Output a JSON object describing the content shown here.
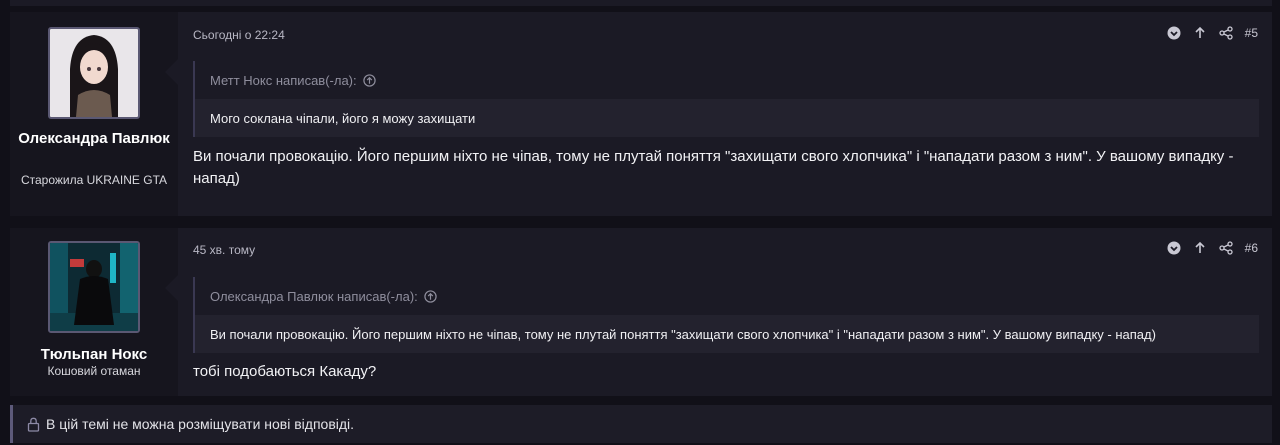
{
  "posts": [
    {
      "user": {
        "name": "Олександра Павлюк",
        "title": "Старожила UKRAINE GTA"
      },
      "time": "Сьогодні о 22:24",
      "number": "#5",
      "quote": {
        "author": "Метт Нокс написав(-ла):",
        "text": "Мого соклана чіпали, його я можу захищати"
      },
      "message": "Ви почали провокацію. Його першим ніхто не чіпав, тому не плутай поняття \"захищати свого хлопчика\" і \"нападати разом з ним\". У вашому випадку - напад)"
    },
    {
      "user": {
        "name": "Тюльпан Нокс",
        "title": "Кошовий отаман"
      },
      "time": "45 хв. тому",
      "number": "#6",
      "quote": {
        "author": "Олександра Павлюк написав(-ла):",
        "text": "Ви почали провокацію. Його першим ніхто не чіпав, тому не плутай поняття \"захищати свого хлопчика\" і \"нападати разом з ним\". У вашому випадку - напад)"
      },
      "message": "тобі подобаються Какаду?"
    }
  ],
  "locked_notice": "В цій темі не можна розміщувати нові відповіді."
}
